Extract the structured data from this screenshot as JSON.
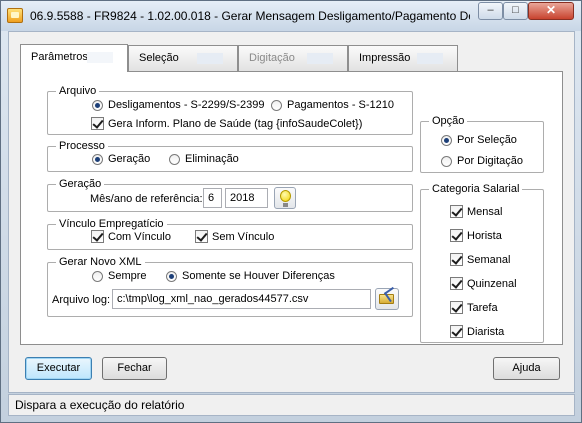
{
  "window": {
    "title": "06.9.5588 - FR9824 - 1.02.00.018 - Gerar Mensagem Desligamento/Pagamento De",
    "controls": {
      "minimize": "–",
      "maximize": "□",
      "close": "✕"
    }
  },
  "tabs": [
    {
      "label": "Parâmetros"
    },
    {
      "label": "Seleção"
    },
    {
      "label": "Digitação"
    },
    {
      "label": "Impressão"
    }
  ],
  "arquivo": {
    "legend": "Arquivo",
    "radio_desligamentos": "Desligamentos - S-2299/S-2399",
    "radio_pagamentos": "Pagamentos - S-1210",
    "check_plano_saude": "Gera Inform. Plano de Saúde (tag {infoSaudeColet})"
  },
  "processo": {
    "legend": "Processo",
    "radio_geracao": "Geração",
    "radio_eliminacao": "Eliminação"
  },
  "geracao": {
    "legend": "Geração",
    "mes_ano_label": "Mês/ano de referência:",
    "mes_value": "6",
    "ano_value": "2018"
  },
  "vinculo": {
    "legend": "Vínculo Empregatício",
    "com_vinculo": "Com Vínculo",
    "sem_vinculo": "Sem Vínculo"
  },
  "gerar_xml": {
    "legend": "Gerar Novo XML",
    "radio_sempre": "Sempre",
    "radio_diferencas": "Somente se Houver Diferenças",
    "arquivo_log_label": "Arquivo log:",
    "arquivo_log_value": "c:\\tmp\\log_xml_nao_gerados44577.csv"
  },
  "opcao": {
    "legend": "Opção",
    "por_selecao": "Por Seleção",
    "por_digitacao": "Por Digitação"
  },
  "categoria": {
    "legend": "Categoria Salarial",
    "items": [
      {
        "label": "Mensal"
      },
      {
        "label": "Horista"
      },
      {
        "label": "Semanal"
      },
      {
        "label": "Quinzenal"
      },
      {
        "label": "Tarefa"
      },
      {
        "label": "Diarista"
      }
    ]
  },
  "buttons": {
    "executar": "Executar",
    "fechar": "Fechar",
    "ajuda": "Ajuda"
  },
  "status": "Dispara a execução do relatório"
}
